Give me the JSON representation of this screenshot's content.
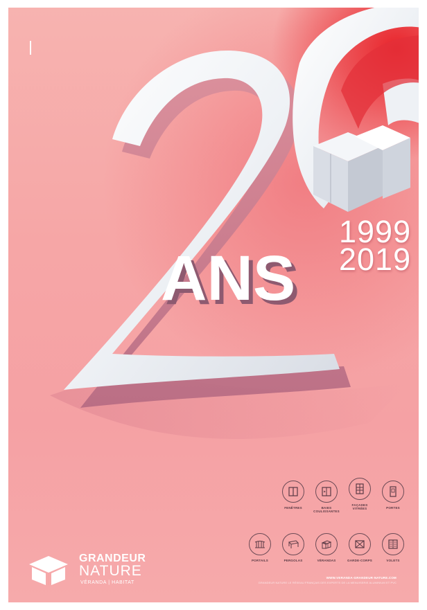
{
  "poster": {
    "years": {
      "start": "1999",
      "end": "2019"
    },
    "ans_text": "ANS",
    "colors": {
      "background": "#f6a6a6",
      "accent_red": "#e8242b",
      "ink": "#5a3a45",
      "white": "#ffffff"
    }
  },
  "products": [
    {
      "label": "FENÊTRES",
      "icon": "window-icon"
    },
    {
      "label": "BAIES\nCOULISSANTES",
      "icon": "sliding-door-icon"
    },
    {
      "label": "FAÇADES\nVITRÉES",
      "icon": "glass-facade-icon"
    },
    {
      "label": "PORTES",
      "icon": "door-icon"
    },
    {
      "label": "PORTAILS",
      "icon": "gate-icon"
    },
    {
      "label": "PERGOLAS",
      "icon": "pergola-icon"
    },
    {
      "label": "VÉRANDAS",
      "icon": "veranda-icon"
    },
    {
      "label": "GARDE-CORPS",
      "icon": "railing-icon"
    },
    {
      "label": "VOLETS",
      "icon": "shutter-icon"
    }
  ],
  "brand": {
    "line1": "GRANDEUR",
    "line2": "NATURE",
    "tagline": "VÉRANDA | HABITAT",
    "website": "WWW.VERANDA-GRANDEUR-NATURE.COM",
    "claim": "GRANDEUR NATURE LE RÉSEAU FRANÇAIS DES EXPERTS DE LA MENUISERIE ALUMINIUM ET PVC"
  }
}
